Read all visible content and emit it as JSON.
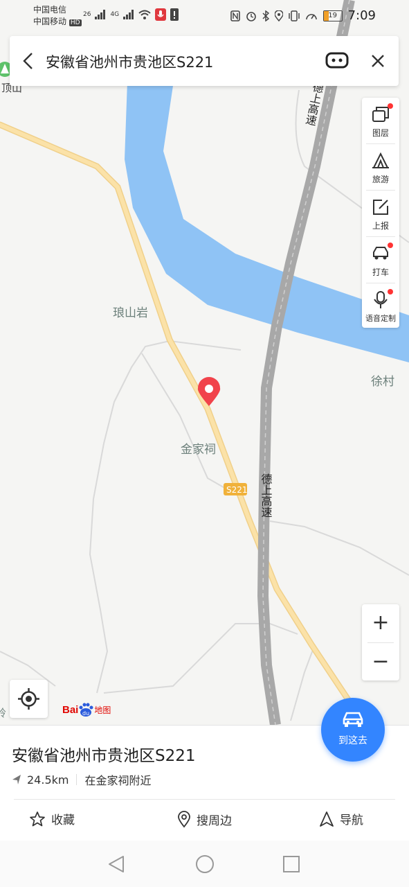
{
  "status_bar": {
    "carrier1": "中国电信",
    "carrier2": "中国移动",
    "hd": "HD",
    "net1": "26",
    "net2": "4G",
    "battery": "19",
    "time": "7:09"
  },
  "search": {
    "query": "安徽省池州市贵池区S221"
  },
  "map": {
    "labels": {
      "langshanyan": "琅山岩",
      "jinjiaci": "金家祠",
      "xucun": "徐村",
      "peak": "顶山",
      "highway_top": "德上高速",
      "highway_mid": "德上高速",
      "road_badge": "S221",
      "edge_char": "岭"
    }
  },
  "tools": [
    {
      "label": "图层",
      "icon": "layers-icon",
      "dot": true
    },
    {
      "label": "旅游",
      "icon": "travel-icon",
      "dot": false
    },
    {
      "label": "上报",
      "icon": "report-icon",
      "dot": false
    },
    {
      "label": "打车",
      "icon": "taxi-icon",
      "dot": true
    },
    {
      "label": "语音定制",
      "icon": "microphone-icon",
      "dot": true
    }
  ],
  "zoom": {
    "in": "+",
    "out": "−"
  },
  "logo": {
    "baidu": "Bai",
    "du": "du",
    "ditu": "地图"
  },
  "goto_button": {
    "label": "到这去"
  },
  "poi": {
    "title": "安徽省池州市贵池区S221",
    "distance": "24.5km",
    "nearby": "在金家祠附近"
  },
  "actions": {
    "favorite": "收藏",
    "nearby_search": "搜周边",
    "navigate": "导航"
  },
  "colors": {
    "accent": "#3385ff",
    "river": "#8fc3f5",
    "road": "#fbdc9a",
    "highway": "#a8a8a8",
    "pin": "#f1434b"
  }
}
